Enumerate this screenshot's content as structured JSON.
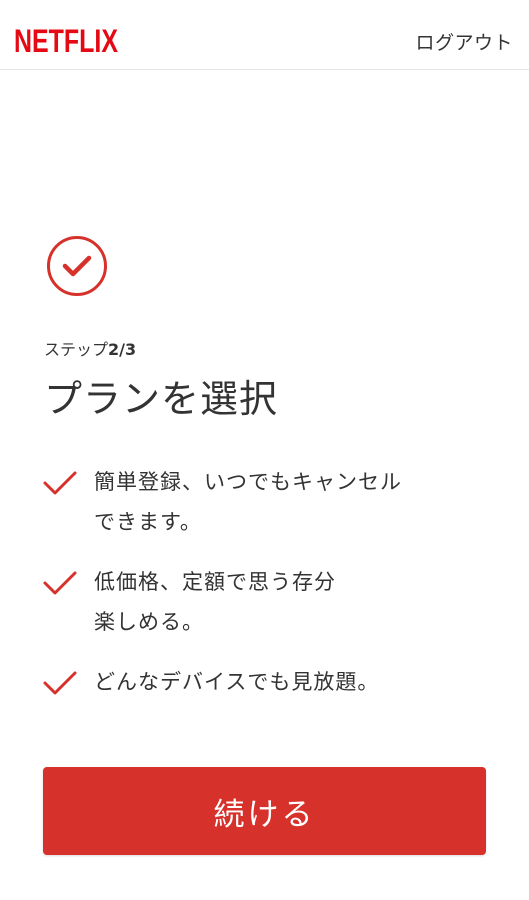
{
  "header": {
    "logo_text": "NETFLIX",
    "logout_label": "ログアウト"
  },
  "step": {
    "icon": "check-circle-icon",
    "label_prefix": "ステップ",
    "label_count": "2/3",
    "title": "プランを選択"
  },
  "features": [
    {
      "icon": "checkmark-icon",
      "text": "簡単登録、いつでもキャンセル\nできます。"
    },
    {
      "icon": "checkmark-icon",
      "text": "低価格、定額で思う存分\n楽しめる。"
    },
    {
      "icon": "checkmark-icon",
      "text": "どんなデバイスでも見放題。"
    }
  ],
  "continue_label": "続ける",
  "colors": {
    "brand_red": "#e50914",
    "accent_red": "#d6312a",
    "text": "#333333",
    "background": "#ffffff"
  }
}
